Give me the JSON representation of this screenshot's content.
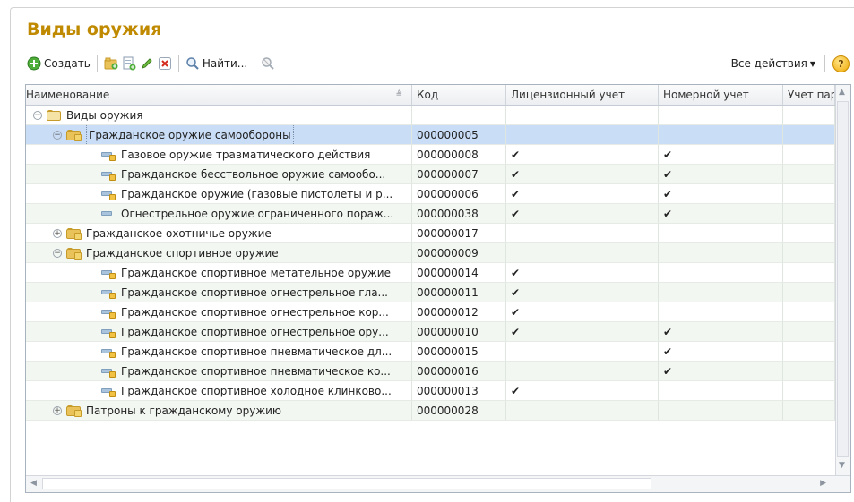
{
  "header": {
    "title": "Виды оружия"
  },
  "toolbar": {
    "create_label": "Создать",
    "find_label": "Найти...",
    "all_actions_label": "Все действия",
    "help_label": "?"
  },
  "table": {
    "columns": [
      "Наименование",
      "Код",
      "Лицензионный учет",
      "Номерной учет",
      "Учет пар"
    ],
    "check_mark": "✔",
    "rows": [
      {
        "name": "Виды оружия",
        "code": "",
        "lic": "",
        "num": "",
        "type": "folder-root"
      },
      {
        "name": "Гражданское оружие самообороны",
        "code": "000000005",
        "lic": "",
        "num": "",
        "type": "folder-open"
      },
      {
        "name": "Газовое оружие травматического действия",
        "code": "000000008",
        "lic": "✔",
        "num": "✔",
        "type": "item"
      },
      {
        "name": "Гражданское бесствольное оружие самообо...",
        "code": "000000007",
        "lic": "✔",
        "num": "✔",
        "type": "item"
      },
      {
        "name": "Гражданское оружие (газовые пистолеты и р...",
        "code": "000000006",
        "lic": "✔",
        "num": "✔",
        "type": "item"
      },
      {
        "name": "Огнестрельное оружие ограниченного пораж...",
        "code": "000000038",
        "lic": "✔",
        "num": "✔",
        "type": "item-nodot"
      },
      {
        "name": "Гражданское охотничье оружие",
        "code": "000000017",
        "lic": "",
        "num": "",
        "type": "folder-closed"
      },
      {
        "name": "Гражданское спортивное оружие",
        "code": "000000009",
        "lic": "",
        "num": "",
        "type": "folder-open"
      },
      {
        "name": "Гражданское спортивное метательное оружие",
        "code": "000000014",
        "lic": "✔",
        "num": "",
        "type": "item"
      },
      {
        "name": "Гражданское спортивное огнестрельное гла...",
        "code": "000000011",
        "lic": "✔",
        "num": "",
        "type": "item"
      },
      {
        "name": "Гражданское спортивное огнестрельное кор...",
        "code": "000000012",
        "lic": "✔",
        "num": "",
        "type": "item"
      },
      {
        "name": "Гражданское спортивное огнестрельное ору...",
        "code": "000000010",
        "lic": "✔",
        "num": "✔",
        "type": "item"
      },
      {
        "name": "Гражданское спортивное пневматическое дл...",
        "code": "000000015",
        "lic": "",
        "num": "✔",
        "type": "item"
      },
      {
        "name": "Гражданское спортивное пневматическое ко...",
        "code": "000000016",
        "lic": "",
        "num": "✔",
        "type": "item"
      },
      {
        "name": "Гражданское спортивное холодное клинково...",
        "code": "000000013",
        "lic": "✔",
        "num": "",
        "type": "item"
      },
      {
        "name": "Патроны к гражданскому оружию",
        "code": "000000028",
        "lic": "",
        "num": "",
        "type": "folder-closed"
      }
    ]
  }
}
